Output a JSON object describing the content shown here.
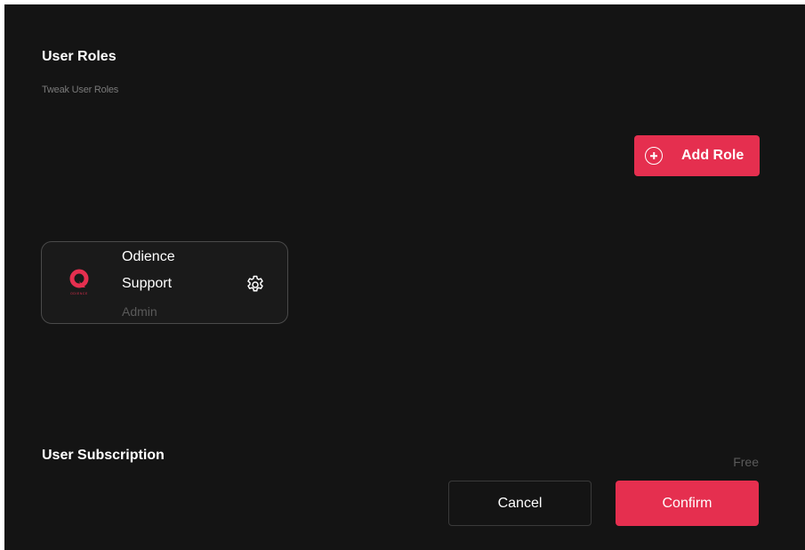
{
  "user_roles": {
    "title": "User Roles",
    "subtitle": "Tweak User Roles",
    "add_role_label": "Add Role",
    "roles": [
      {
        "name_line1": "Odience",
        "name_line2": "Support",
        "role": "Admin",
        "logo_text": "ODIENCE"
      }
    ]
  },
  "subscription": {
    "title": "User Subscription",
    "plan": "Free"
  },
  "actions": {
    "cancel_label": "Cancel",
    "confirm_label": "Confirm"
  },
  "colors": {
    "accent": "#e52f4f",
    "background": "#141414",
    "card_border": "#4a4a4a",
    "muted_text": "#5a5a5a"
  },
  "icons": [
    "add-circle-icon",
    "odience-logo",
    "gear-icon"
  ]
}
